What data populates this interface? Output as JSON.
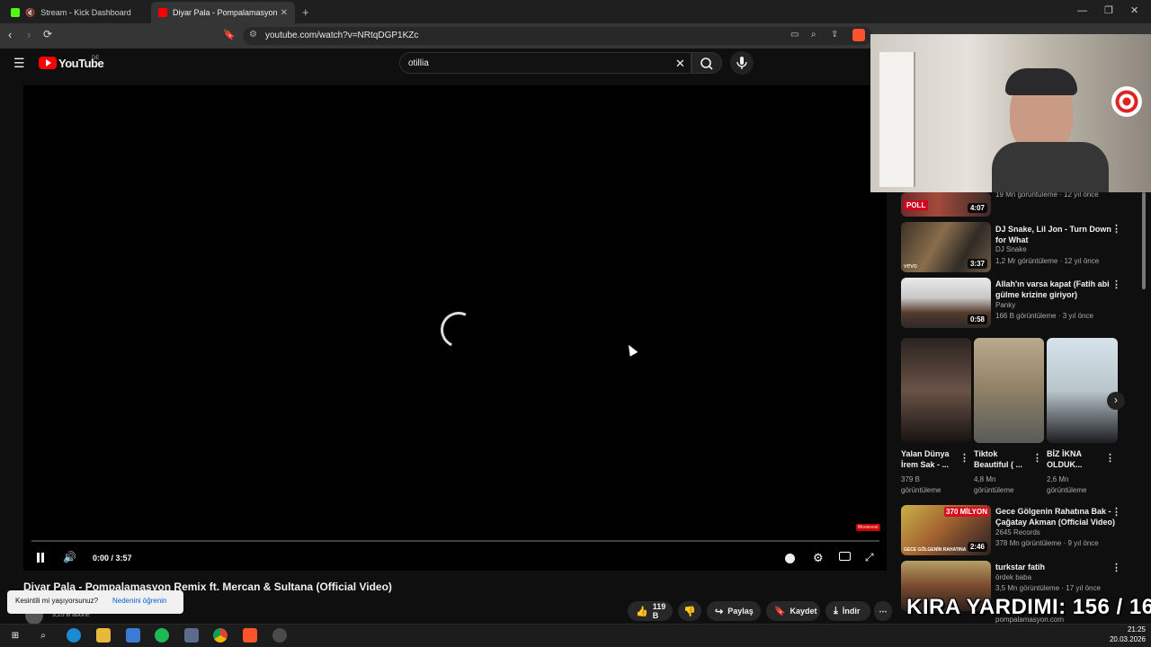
{
  "browser": {
    "tabs": [
      {
        "title": "Stream - Kick Dashboard"
      },
      {
        "title": "Diyar Pala - Pompalamasyon Rem"
      }
    ],
    "url": "youtube.com/watch?v=NRtqDGP1KZc"
  },
  "youtube": {
    "logo_text": "YouTube",
    "region": "DE",
    "search_value": "otillia"
  },
  "player": {
    "time": "0:00 / 3:57",
    "watermark": "Moviesoul"
  },
  "video": {
    "title": "Diyar Pala - Pompalamasyon Remix ft. Mercan & Sultana (Official Video)",
    "subscribers": "3,25 B abone",
    "likes": "119 B",
    "share_label": "Paylaş",
    "save_label": "Kaydet",
    "download_label": "İndir"
  },
  "toast": {
    "question": "Kesintili mi yaşıyorsunuz?",
    "link": "Nedenini öğrenin"
  },
  "sidebar": {
    "top_meta": "19 Mn görüntüleme · 12 yıl önce",
    "top_duration": "4:07",
    "videos": [
      {
        "title_l1": "DJ Snake, Lil Jon - Turn Down",
        "title_l2": "for What",
        "channel": "DJ Snake",
        "meta": "1,2 Mr görüntüleme · 12 yıl önce",
        "duration": "3:37"
      },
      {
        "title_l1": "Allah'ın varsa kapat (Fatih abi",
        "title_l2": "gülme krizine giriyor)",
        "channel": "Panky",
        "meta": "166 B görüntüleme · 3 yıl önce",
        "duration": "0:58"
      }
    ],
    "shorts": [
      {
        "title_l1": "Yalan Dünya",
        "title_l2": "İrem Sak - ...",
        "views_l1": "379 B",
        "views_l2": "görüntüleme"
      },
      {
        "title_l1": "Tiktok",
        "title_l2": "Beautiful ( ...",
        "views_l1": "4,8 Mn",
        "views_l2": "görüntüleme"
      },
      {
        "title_l1": "BİZ İKNA",
        "title_l2": "OLDUK...",
        "views_l1": "2,6 Mn",
        "views_l2": "görüntüleme"
      }
    ],
    "videos2": [
      {
        "title_l1": "Gece Gölgenin Rahatına Bak -",
        "title_l2": "Çağatay Akman (Official Video)",
        "channel": "2645 Records",
        "meta": "378 Mn görüntüleme · 9 yıl önce",
        "duration": "2:46",
        "badge": "370 MİLYON",
        "thumb_caption": "GECE GÖLGENİN RAHATINA"
      },
      {
        "title_l1": "turkstar fatih",
        "title_l2": "",
        "channel": "ördek baba",
        "meta": "3,5 Mn görüntüleme · 17 yıl önce",
        "duration": ""
      }
    ],
    "cut_off_meta": "pompalamasyon.com"
  },
  "overlay": {
    "kira_text": "KIRA YARDIMI: 156 / 160"
  },
  "taskbar": {
    "time": "21:25",
    "date": "20.03.2026"
  },
  "colors": {
    "youtube_red": "#ff0000",
    "link_blue": "#3ea6ff",
    "kick_green": "#53fc18"
  }
}
